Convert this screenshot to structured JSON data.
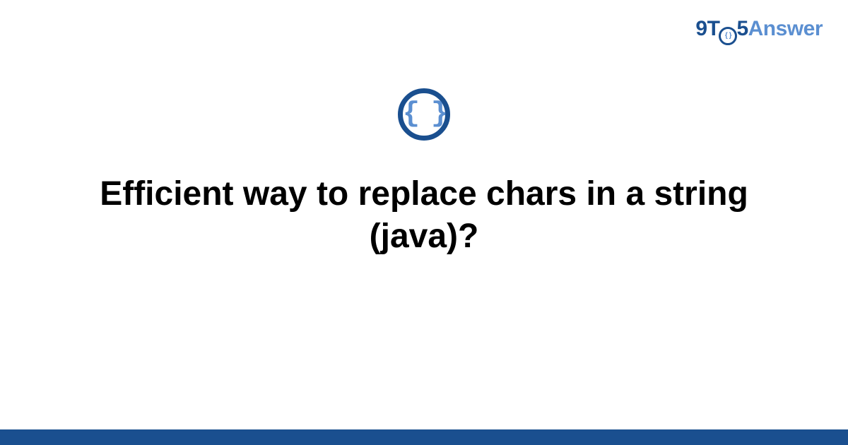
{
  "logo": {
    "part_9t": "9T",
    "ring_inner": "{ }",
    "part_5": "5",
    "part_answer": "Answer"
  },
  "category_icon": {
    "name": "code-braces-icon",
    "glyph": "{ }"
  },
  "question": {
    "title": "Efficient way to replace chars in a string (java)?"
  },
  "colors": {
    "brand_dark": "#1a4f8f",
    "brand_light": "#5b8fd1",
    "text": "#000000",
    "background": "#ffffff"
  }
}
